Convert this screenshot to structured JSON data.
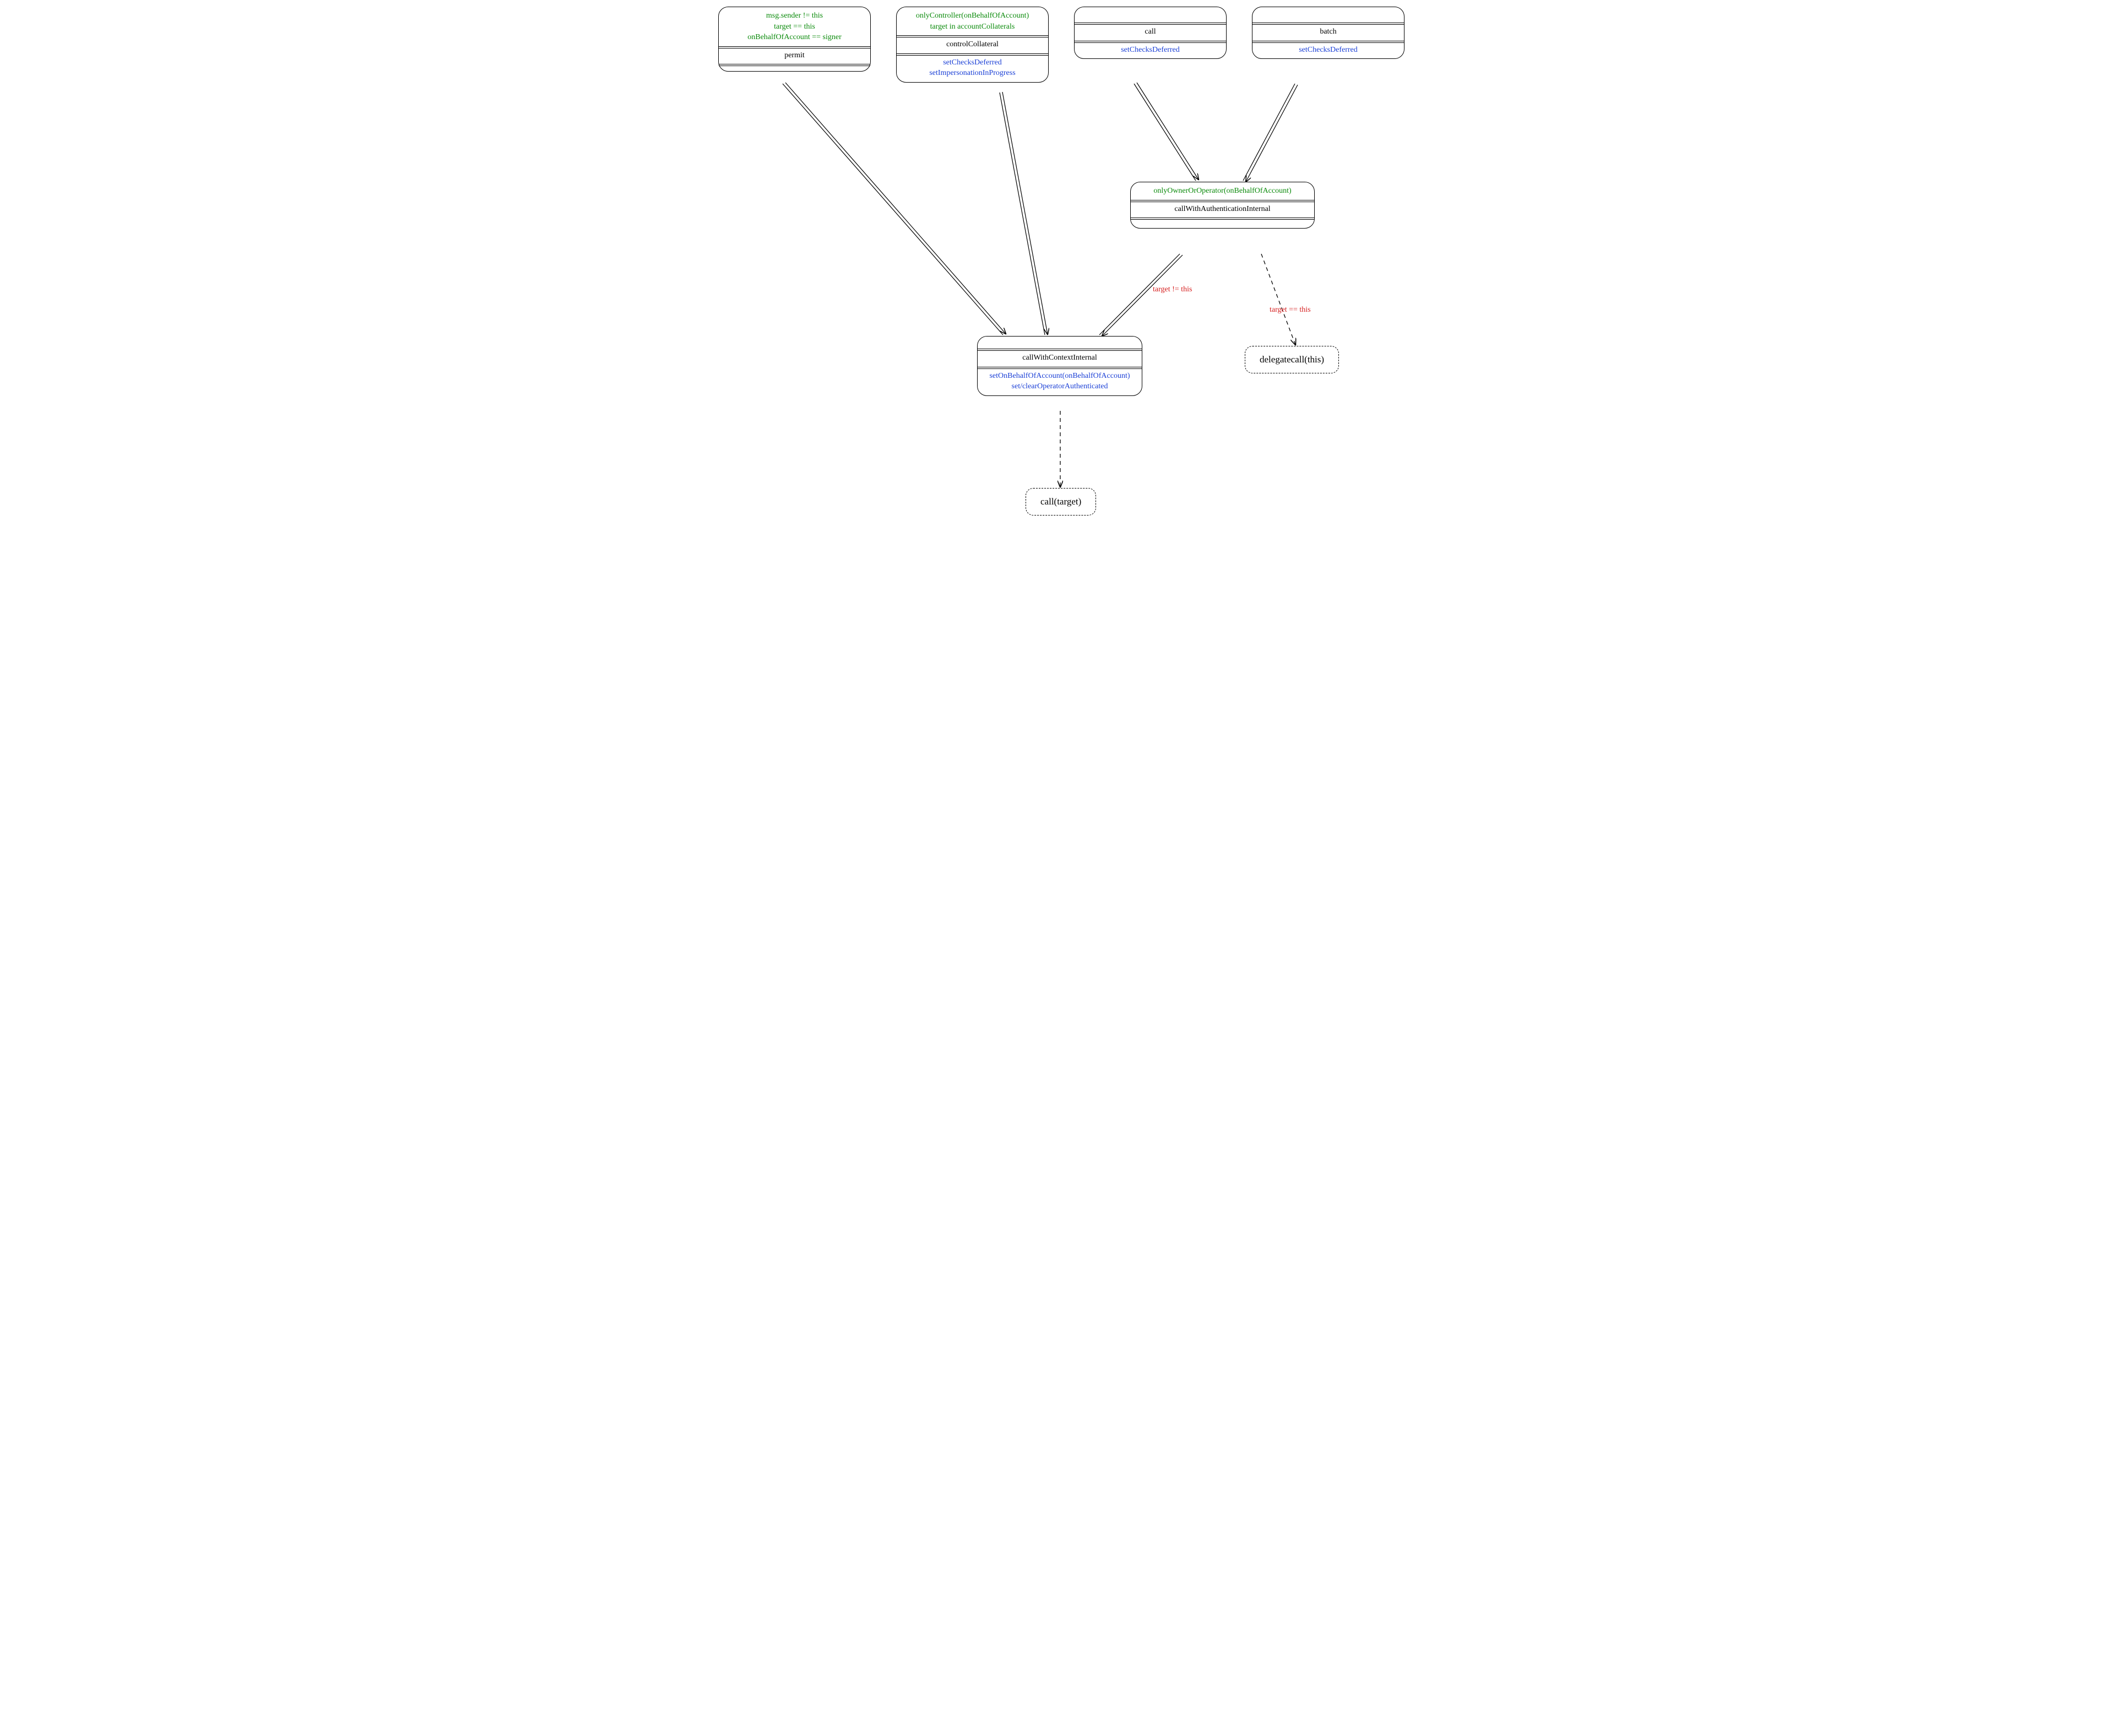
{
  "nodes": {
    "permit": {
      "pre": [
        "msg.sender != this",
        "target == this",
        "onBehalfOfAccount == signer"
      ],
      "title": "permit",
      "post": []
    },
    "controlCollateral": {
      "pre": [
        "onlyController(onBehalfOfAccount)",
        "target in accountCollaterals"
      ],
      "title": "controlCollateral",
      "post": [
        "setChecksDeferred",
        "setImpersonationInProgress"
      ]
    },
    "call": {
      "pre": [],
      "title": "call",
      "post": [
        "setChecksDeferred"
      ]
    },
    "batch": {
      "pre": [],
      "title": "batch",
      "post": [
        "setChecksDeferred"
      ]
    },
    "callWithAuth": {
      "pre": [
        "onlyOwnerOrOperator(onBehalfOfAccount)"
      ],
      "title": "callWithAuthenticationInternal",
      "post": []
    },
    "callWithContext": {
      "pre": [],
      "title": "callWithContextInternal",
      "post": [
        "setOnBehalfOfAccount(onBehalfOfAccount)",
        "set/clearOperatorAuthenticated"
      ]
    }
  },
  "terminals": {
    "delegatecall": "delegatecall(this)",
    "callTarget": "call(target)"
  },
  "edgeLabels": {
    "targetNeq": "target != this",
    "targetEq": "target == this"
  }
}
